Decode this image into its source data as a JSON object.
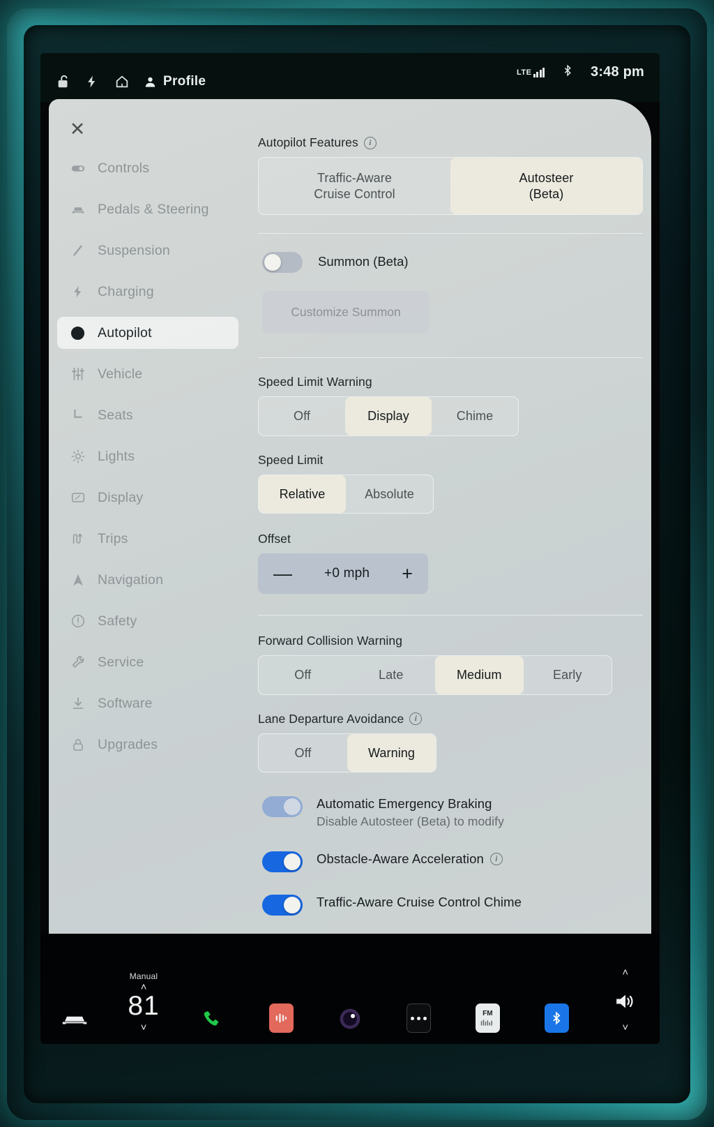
{
  "status_bar": {
    "left_icons": [
      "unlock-icon",
      "charging-bolt-icon",
      "home-icon"
    ],
    "profile_label": "Profile",
    "network_label": "LTE",
    "bluetooth_icon": "bluetooth-icon",
    "time": "3:48 pm"
  },
  "settings": {
    "close_label": "✕",
    "sidebar": [
      {
        "label": "Controls",
        "icon": "toggle-icon",
        "active": false
      },
      {
        "label": "Pedals & Steering",
        "icon": "car-icon",
        "active": false
      },
      {
        "label": "Suspension",
        "icon": "suspension-icon",
        "active": false
      },
      {
        "label": "Charging",
        "icon": "bolt-icon",
        "active": false
      },
      {
        "label": "Autopilot",
        "icon": "steering-wheel-icon",
        "active": true
      },
      {
        "label": "Vehicle",
        "icon": "sliders-icon",
        "active": false
      },
      {
        "label": "Seats",
        "icon": "seat-icon",
        "active": false
      },
      {
        "label": "Lights",
        "icon": "light-icon",
        "active": false
      },
      {
        "label": "Display",
        "icon": "display-icon",
        "active": false
      },
      {
        "label": "Trips",
        "icon": "trips-icon",
        "active": false
      },
      {
        "label": "Navigation",
        "icon": "navigation-arrow-icon",
        "active": false
      },
      {
        "label": "Safety",
        "icon": "alert-circle-icon",
        "active": false
      },
      {
        "label": "Service",
        "icon": "wrench-icon",
        "active": false
      },
      {
        "label": "Software",
        "icon": "download-icon",
        "active": false
      },
      {
        "label": "Upgrades",
        "icon": "lock-icon",
        "active": false
      }
    ]
  },
  "autopilot": {
    "features": {
      "label": "Autopilot Features",
      "options": [
        "Traffic-Aware\nCruise Control",
        "Autosteer\n(Beta)"
      ],
      "option_1_line1": "Traffic-Aware",
      "option_1_line2": "Cruise Control",
      "option_2_line1": "Autosteer",
      "option_2_line2": "(Beta)",
      "selected": "Autosteer (Beta)"
    },
    "summon": {
      "label": "Summon (Beta)",
      "enabled": false,
      "customize_label": "Customize Summon",
      "customize_enabled": false
    },
    "speed_limit_warning": {
      "label": "Speed Limit Warning",
      "options": [
        "Off",
        "Display",
        "Chime"
      ],
      "selected": "Display"
    },
    "speed_limit": {
      "label": "Speed Limit",
      "options": [
        "Relative",
        "Absolute"
      ],
      "selected": "Relative"
    },
    "offset": {
      "label": "Offset",
      "minus": "—",
      "value": "+0 mph",
      "plus": "+"
    },
    "forward_collision_warning": {
      "label": "Forward Collision Warning",
      "options": [
        "Off",
        "Late",
        "Medium",
        "Early"
      ],
      "selected": "Medium"
    },
    "lane_departure_avoidance": {
      "label": "Lane Departure Avoidance",
      "options": [
        "Off",
        "Warning"
      ],
      "selected": "Warning"
    },
    "toggles": [
      {
        "title": "Automatic Emergency Braking",
        "subtitle": "Disable Autosteer (Beta) to modify",
        "on": true,
        "disabled": true,
        "has_info": false
      },
      {
        "title": "Obstacle-Aware Acceleration",
        "subtitle": "",
        "on": true,
        "disabled": false,
        "has_info": true
      },
      {
        "title": "Traffic-Aware Cruise Control Chime",
        "subtitle": "",
        "on": true,
        "disabled": false,
        "has_info": false
      }
    ]
  },
  "dock": {
    "car_icon": "car-icon",
    "climate_mode": "Manual",
    "climate_chevron_up": "˄",
    "climate_chevron_down": "˅",
    "temperature": "81",
    "phone_icon": "phone-icon",
    "media_icon": "media-icon",
    "camera_icon": "camera-icon",
    "more_icon": "more-dots-icon",
    "fm_label": "FM",
    "bluetooth_icon": "bluetooth-icon",
    "volume_icon": "volume-icon",
    "volume_chevron_up": "˄",
    "volume_chevron_down": "˅"
  },
  "colors": {
    "accent_blue": "#1667e0",
    "accent_blue_dim": "#92acd4",
    "selected_segment": "#eceade",
    "panel_bg": "#cfd5d4",
    "ambient_teal": "#2eb3b1"
  }
}
